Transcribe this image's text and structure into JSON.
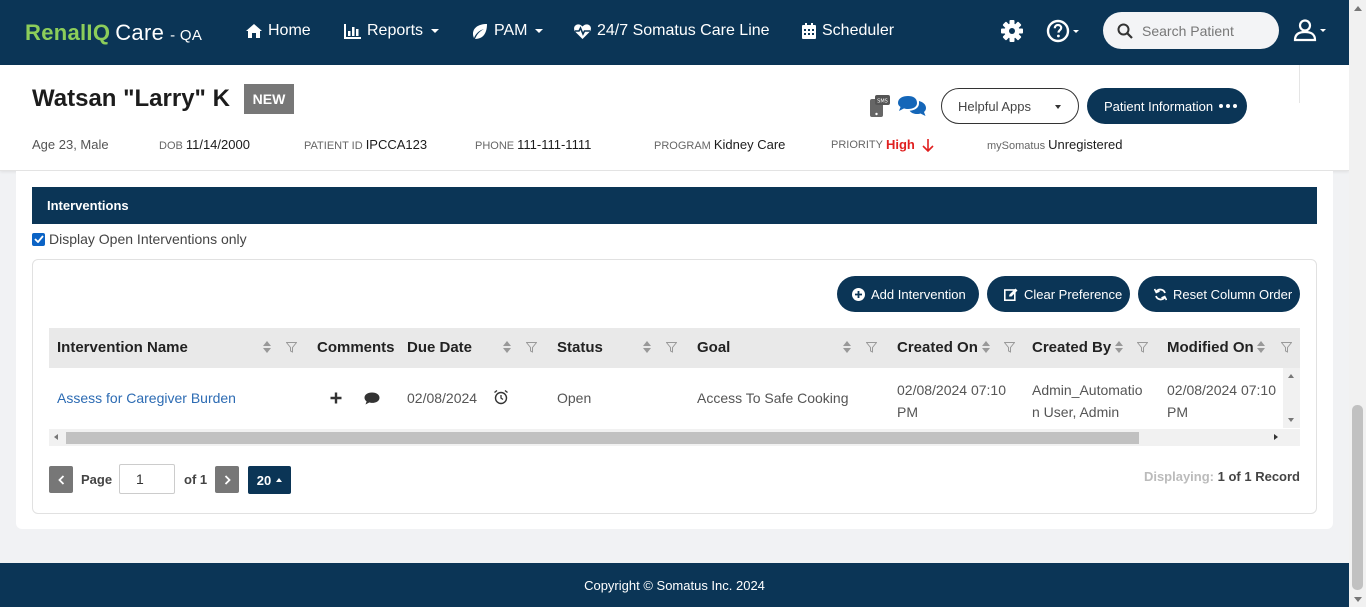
{
  "brand": {
    "name_colored": "RenalIQ",
    "name_plain": "Care",
    "env": "- QA"
  },
  "nav": {
    "home": "Home",
    "reports": "Reports",
    "pam": "PAM",
    "careline": "24/7 Somatus Care Line",
    "scheduler": "Scheduler",
    "search_placeholder": "Search Patient",
    "icons": [
      "settings-gear-icon",
      "help-question-icon",
      "user-account-icon"
    ]
  },
  "patient": {
    "name": "Watsan \"Larry\" K",
    "badge": "NEW",
    "age_sex": "Age 23, Male",
    "dob_label": "DOB",
    "dob": "11/14/2000",
    "id_label": "PATIENT ID",
    "id": "IPCCA123",
    "phone_label": "PHONE",
    "phone": "111-111-1111",
    "program_label": "PROGRAM",
    "program": "Kidney Care",
    "priority_label": "PRIORITY",
    "priority": "High",
    "mysomatus_label": "mySomatus",
    "mysomatus": "Unregistered"
  },
  "header_buttons": {
    "helpful_apps": "Helpful Apps",
    "patient_info": "Patient Information"
  },
  "section": {
    "title": "Interventions",
    "filter_checkbox": "Display Open Interventions only",
    "filter_checked": true
  },
  "actions": {
    "add": "Add Intervention",
    "clear": "Clear Preference",
    "reset": "Reset Column Order"
  },
  "grid": {
    "columns": [
      "Intervention Name",
      "Comments",
      "Due Date",
      "Status",
      "Goal",
      "Created On",
      "Created By",
      "Modified On"
    ],
    "rows": [
      {
        "intervention_name": "Assess for Caregiver Burden",
        "due_date": "02/08/2024",
        "status": "Open",
        "goal": "Access To Safe Cooking",
        "created_on_line1": "02/08/2024 07:10",
        "created_on_line2": "PM",
        "created_by_line1": "Admin_Automatio",
        "created_by_line2": "n User, Admin",
        "modified_on_line1": "02/08/2024 07:10",
        "modified_on_line2": "PM"
      }
    ]
  },
  "pager": {
    "page_label": "Page",
    "page_value": "1",
    "of_label": "of 1",
    "page_size": "20",
    "displaying_label": "Displaying:",
    "displaying_value": "1 of 1 Record"
  },
  "footer": {
    "copyright": "Copyright © Somatus Inc. 2024"
  },
  "colors": {
    "navy": "#0b3556",
    "brand_green": "#8ccd5a",
    "priority_red": "#e02020",
    "link_blue": "#2c6bb3"
  }
}
